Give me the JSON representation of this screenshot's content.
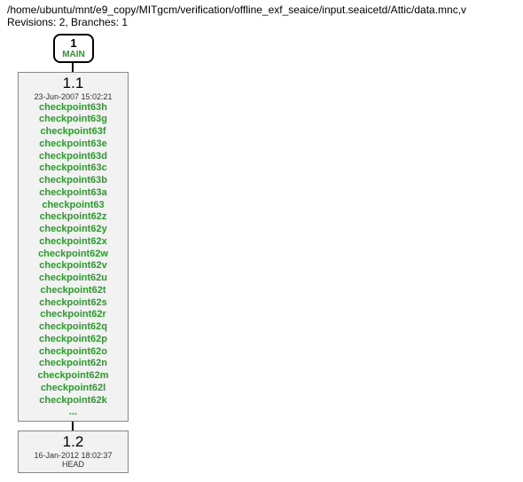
{
  "header": {
    "path": "/home/ubuntu/mnt/e9_copy/MITgcm/verification/offline_exf_seaice/input.seaicetd/Attic/data.mnc,v",
    "meta": "Revisions: 2, Branches: 1"
  },
  "branch": {
    "num": "1",
    "label": "MAIN"
  },
  "rev1": {
    "num": "1.1",
    "date": "23-Jun-2007 15:02:21",
    "tags": [
      "checkpoint63h",
      "checkpoint63g",
      "checkpoint63f",
      "checkpoint63e",
      "checkpoint63d",
      "checkpoint63c",
      "checkpoint63b",
      "checkpoint63a",
      "checkpoint63",
      "checkpoint62z",
      "checkpoint62y",
      "checkpoint62x",
      "checkpoint62w",
      "checkpoint62v",
      "checkpoint62u",
      "checkpoint62t",
      "checkpoint62s",
      "checkpoint62r",
      "checkpoint62q",
      "checkpoint62p",
      "checkpoint62o",
      "checkpoint62n",
      "checkpoint62m",
      "checkpoint62l",
      "checkpoint62k"
    ],
    "ellipsis": "..."
  },
  "rev2": {
    "num": "1.2",
    "date": "16-Jan-2012 18:02:37",
    "head": "HEAD"
  }
}
